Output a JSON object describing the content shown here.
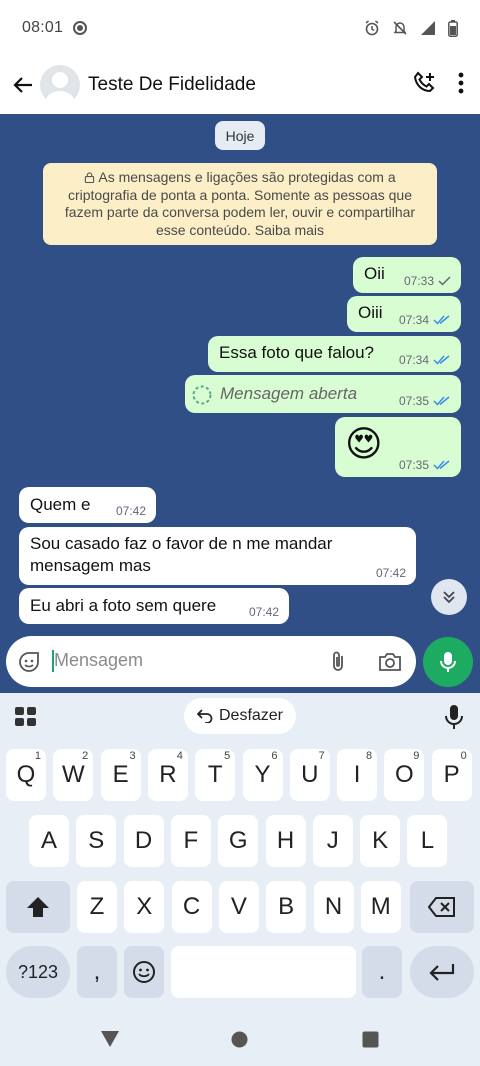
{
  "status": {
    "time": "08:01"
  },
  "header": {
    "title": "Teste De Fidelidade"
  },
  "chat": {
    "date_chip": "Hoje",
    "notice": "As mensagens e ligações são protegidas com a criptografia de ponta a ponta. Somente as pessoas que fazem parte da conversa podem ler, ouvir e compartilhar esse conteúdo. Saiba mais",
    "messages": [
      {
        "text": "Oii",
        "time": "07:33"
      },
      {
        "text": "Oiii",
        "time": "07:34"
      },
      {
        "text": "Essa foto que falou?",
        "time": "07:34"
      },
      {
        "text": "Mensagem aberta",
        "time": "07:35"
      },
      {
        "text": "😍",
        "time": "07:35"
      },
      {
        "text": "Quem e",
        "time": "07:42"
      },
      {
        "text": "Sou casado faz o favor de n me mandar mensagem mas",
        "time": "07:42"
      },
      {
        "text": "Eu abri a foto sem quere",
        "time": "07:42"
      }
    ]
  },
  "composer": {
    "placeholder": "Mensagem"
  },
  "keyboard": {
    "undo_label": "Desfazer",
    "row1": [
      {
        "k": "Q",
        "n": "1"
      },
      {
        "k": "W",
        "n": "2"
      },
      {
        "k": "E",
        "n": "3"
      },
      {
        "k": "R",
        "n": "4"
      },
      {
        "k": "T",
        "n": "5"
      },
      {
        "k": "Y",
        "n": "6"
      },
      {
        "k": "U",
        "n": "7"
      },
      {
        "k": "I",
        "n": "8"
      },
      {
        "k": "O",
        "n": "9"
      },
      {
        "k": "P",
        "n": "0"
      }
    ],
    "row2": [
      "A",
      "S",
      "D",
      "F",
      "G",
      "H",
      "J",
      "K",
      "L"
    ],
    "row3": [
      "Z",
      "X",
      "C",
      "V",
      "B",
      "N",
      "M"
    ],
    "sym_label": "?123",
    "comma": ",",
    "period": "."
  }
}
